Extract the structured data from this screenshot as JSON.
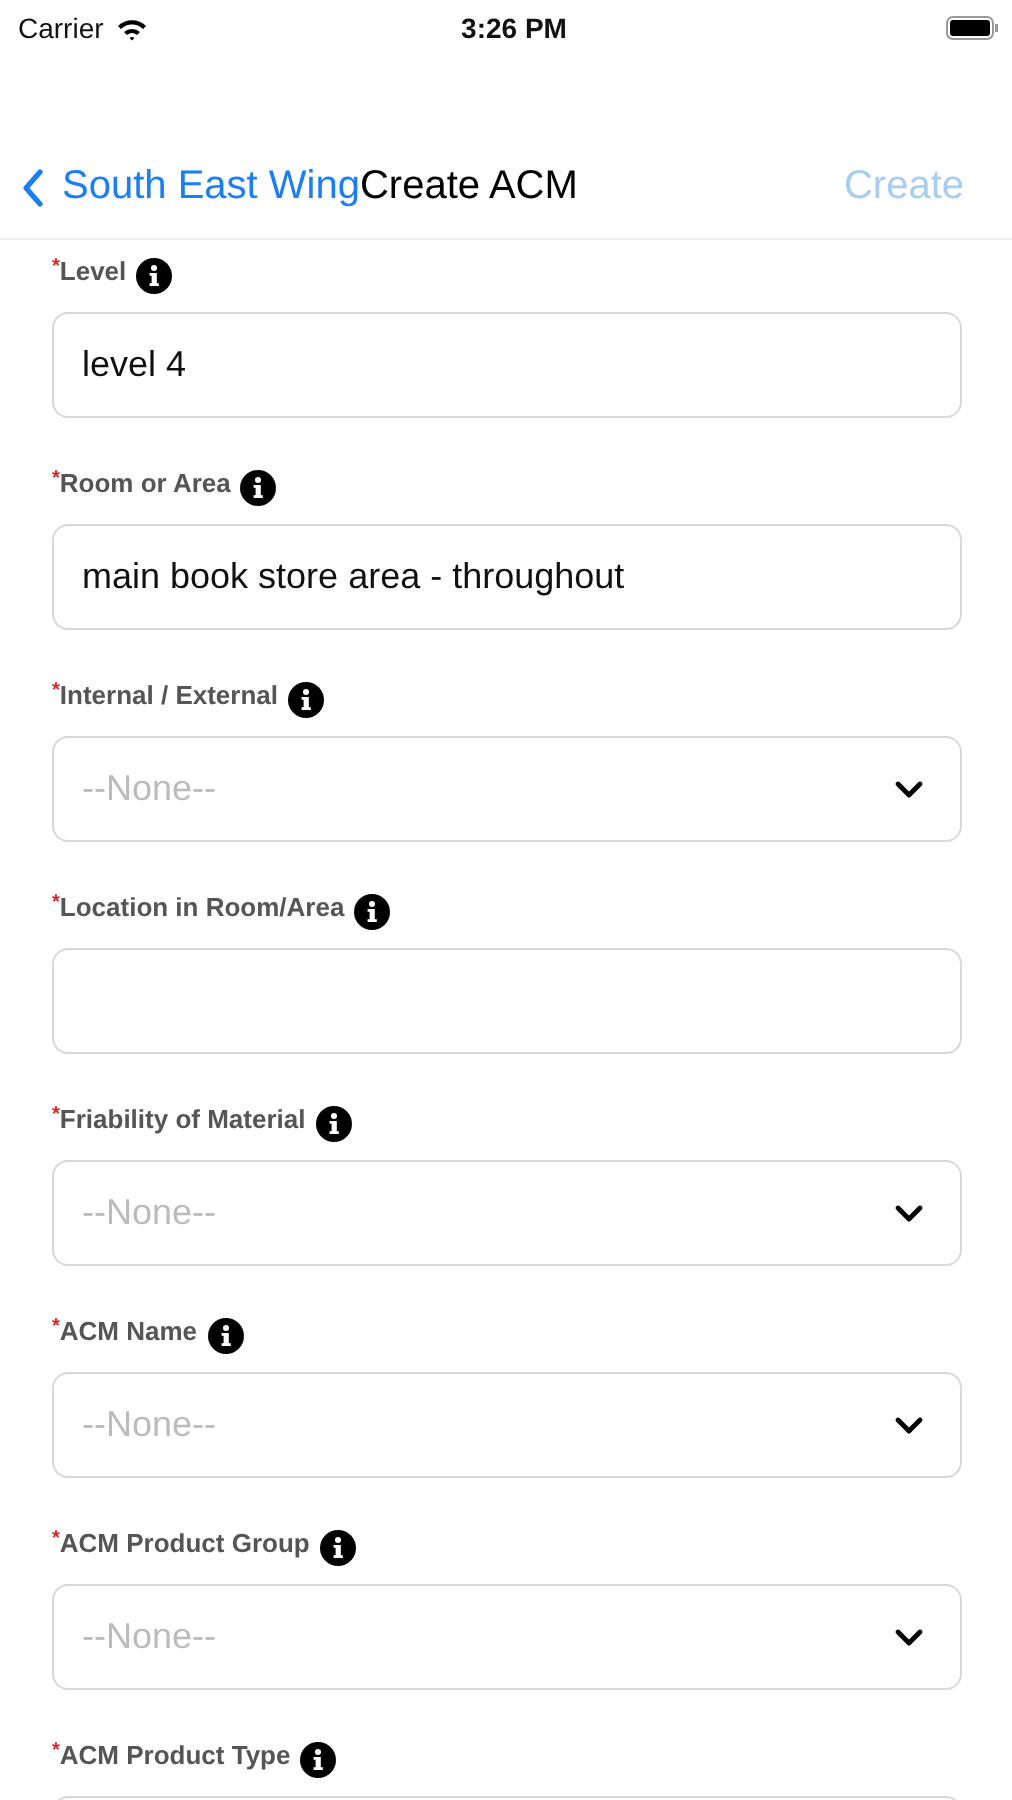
{
  "status_bar": {
    "carrier": "Carrier",
    "time": "3:26 PM"
  },
  "nav": {
    "back": "South East Wing",
    "title": "Create ACM",
    "action": "Create",
    "action_disabled": true
  },
  "fields": [
    {
      "mark": "*",
      "label": "Level",
      "kind": "text",
      "value": "level 4"
    },
    {
      "mark": "*",
      "label": "Room or Area",
      "kind": "text",
      "value": "main book store area - throughout"
    },
    {
      "mark": "*",
      "label": "Internal / External",
      "kind": "picklist",
      "placeholder": "--None--"
    },
    {
      "mark": "*",
      "label": "Location in Room/Area",
      "kind": "text"
    },
    {
      "mark": "*",
      "label": "Friability of Material",
      "kind": "picklist",
      "placeholder": "--None--"
    },
    {
      "mark": "*",
      "label": "ACM Name",
      "kind": "picklist",
      "placeholder": "--None--"
    },
    {
      "mark": "*",
      "label": "ACM Product Group",
      "kind": "picklist",
      "placeholder": "--None--"
    },
    {
      "mark": "*",
      "label": "ACM Product Type",
      "kind": "text"
    }
  ]
}
